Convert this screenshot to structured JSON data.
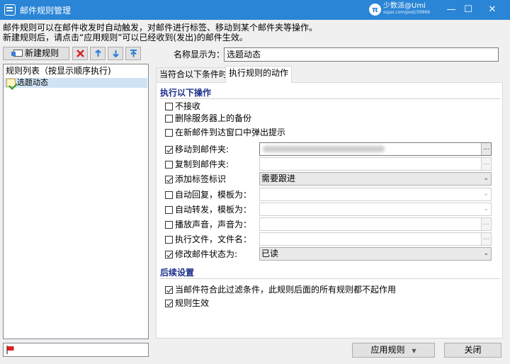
{
  "window": {
    "title": "邮件规则管理",
    "watermark": "少数派@Umi",
    "watermark_sub": "sspai.com/post/39966",
    "controls": {
      "minimize": "—",
      "maximize": "☐",
      "close": "✕"
    }
  },
  "intro": {
    "line1": "邮件规则可以在邮件收发时自动触发，对邮件进行标签、移动到某个邮件夹等操作。",
    "line2": "新建规则后，请点击“应用规则”可以已经收到(发出)的邮件生效。"
  },
  "toolbar": {
    "new_rule_label": "新建规则",
    "icons": [
      "new-rule-icon",
      "delete-icon",
      "move-up-icon",
      "move-down-icon",
      "move-top-icon"
    ]
  },
  "rules_list": {
    "header": "规则列表（按显示顺序执行)",
    "items": [
      {
        "label": "选题动态",
        "selected": true
      }
    ]
  },
  "name_field": {
    "label": "名称显示为：",
    "value": "选题动态"
  },
  "tabs": [
    {
      "label": "当符合以下条件时",
      "active": false
    },
    {
      "label": "执行规则的动作",
      "active": true
    }
  ],
  "actions": {
    "section_title": "执行以下操作",
    "simple": [
      {
        "label": "不接收",
        "checked": false
      },
      {
        "label": "删除服务器上的备份",
        "checked": false
      },
      {
        "label": "在新邮件到达窗口中弹出提示",
        "checked": false
      }
    ],
    "rows": [
      {
        "label": "移动到邮件夹:",
        "checked": true,
        "value": "",
        "button": "..."
      },
      {
        "label": "复制到邮件夹:",
        "checked": false,
        "value": "",
        "button": "..."
      },
      {
        "label": "添加标签标识",
        "checked": true,
        "value": "需要跟进"
      },
      {
        "label": "自动回复，模板为：",
        "checked": false,
        "value": ""
      },
      {
        "label": "自动转发，模板为：",
        "checked": false,
        "value": ""
      },
      {
        "label": "播放声音，声音为：",
        "checked": false,
        "value": "",
        "button": "..."
      },
      {
        "label": "执行文件，文件名：",
        "checked": false,
        "value": "",
        "button": "..."
      },
      {
        "label": "修改邮件状态为:",
        "checked": true,
        "value": "已读"
      }
    ]
  },
  "followup": {
    "section_title": "后续设置",
    "options": [
      {
        "label": "当邮件符合此过滤条件，此规则后面的所有规则都不起作用",
        "checked": true
      },
      {
        "label": "规则生效",
        "checked": true
      }
    ]
  },
  "footer": {
    "apply_label": "应用规则",
    "apply_arrow": "▼",
    "close_label": "关闭",
    "flag_color": "#e02020"
  },
  "colors": {
    "titlebar": "#2b85d6",
    "section_title": "#1f2f8c",
    "selection": "#cfe3f5"
  }
}
